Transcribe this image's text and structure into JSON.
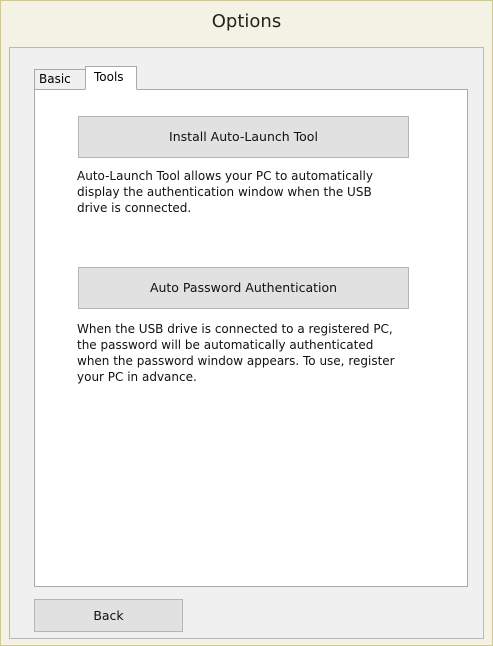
{
  "window": {
    "title": "Options"
  },
  "tabs": [
    {
      "label": "Basic",
      "selected": false
    },
    {
      "label": "Tools",
      "selected": true
    }
  ],
  "tools_tab": {
    "install_button_label": "Install Auto-Launch Tool",
    "install_description": "Auto-Launch Tool allows your PC to automatically display the  authentication window when the USB drive is connected.",
    "auto_password_button_label": "Auto Password Authentication",
    "auto_password_description": "When the USB drive is connected to a registered PC, the password will be automatically authenticated when the password window appears. To use, register your PC in advance."
  },
  "footer": {
    "back_button_label": "Back"
  },
  "colors": {
    "window_frame": "#f3f2e4",
    "button_face": "#e1e1e1",
    "panel_background": "#ffffff"
  }
}
